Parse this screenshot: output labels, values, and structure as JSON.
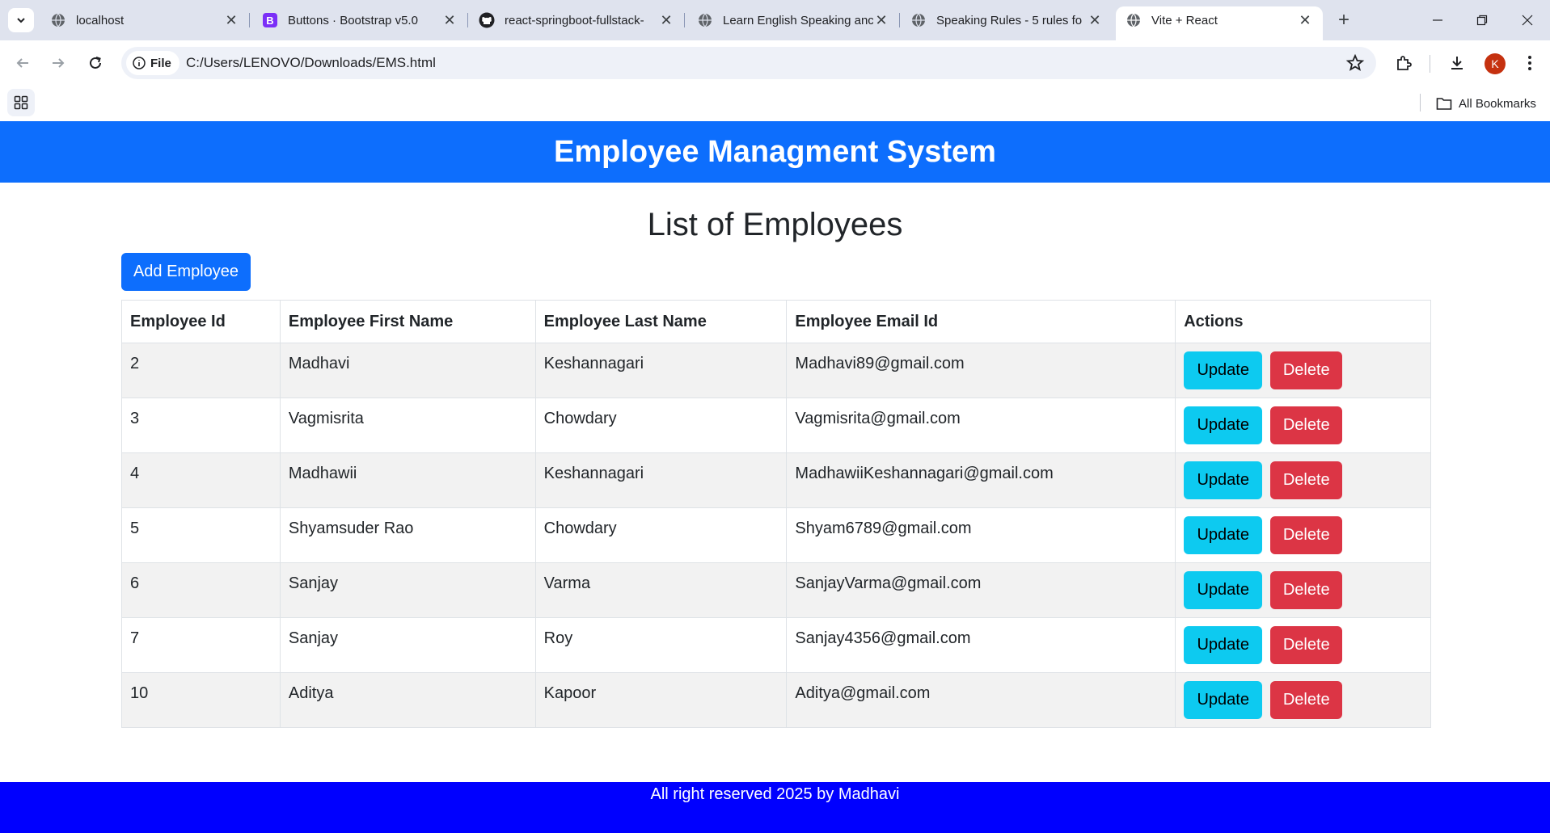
{
  "browser": {
    "tabs": [
      {
        "title": "localhost",
        "icon": "globe-icon",
        "active": false
      },
      {
        "title": "Buttons · Bootstrap v5.0",
        "icon": "bootstrap-icon",
        "active": false
      },
      {
        "title": "react-springboot-fullstack-",
        "icon": "github-icon",
        "active": false
      },
      {
        "title": "Learn English Speaking anc",
        "icon": "globe-icon",
        "active": false
      },
      {
        "title": "Speaking Rules - 5 rules fo",
        "icon": "globe-icon",
        "active": false
      },
      {
        "title": "Vite + React",
        "icon": "globe-icon",
        "active": true
      }
    ],
    "site_chip_label": "File",
    "url": "C:/Users/LENOVO/Downloads/EMS.html",
    "profile_initial": "K",
    "all_bookmarks_label": "All Bookmarks"
  },
  "app": {
    "header_title": "Employee Managment System",
    "list_title": "List of Employees",
    "add_button_label": "Add Employee",
    "columns": [
      "Employee Id",
      "Employee First Name",
      "Employee Last Name",
      "Employee Email Id",
      "Actions"
    ],
    "rows": [
      {
        "id": "2",
        "first": "Madhavi",
        "last": "Keshannagari",
        "email": "Madhavi89@gmail.com"
      },
      {
        "id": "3",
        "first": "Vagmisrita",
        "last": "Chowdary",
        "email": "Vagmisrita@gmail.com"
      },
      {
        "id": "4",
        "first": "Madhawii",
        "last": "Keshannagari",
        "email": "MadhawiiKeshannagari@gmail.com"
      },
      {
        "id": "5",
        "first": "Shyamsuder Rao",
        "last": "Chowdary",
        "email": "Shyam6789@gmail.com"
      },
      {
        "id": "6",
        "first": "Sanjay",
        "last": "Varma",
        "email": "SanjayVarma@gmail.com"
      },
      {
        "id": "7",
        "first": "Sanjay",
        "last": "Roy",
        "email": "Sanjay4356@gmail.com"
      },
      {
        "id": "10",
        "first": "Aditya",
        "last": "Kapoor",
        "email": "Aditya@gmail.com"
      }
    ],
    "update_label": "Update",
    "delete_label": "Delete",
    "footer_text": "All right reserved 2025 by Madhavi"
  },
  "colors": {
    "header_bg": "#0d6efd",
    "update_btn": "#0dcaf0",
    "delete_btn": "#dc3545",
    "footer_bg": "#0000ff"
  }
}
